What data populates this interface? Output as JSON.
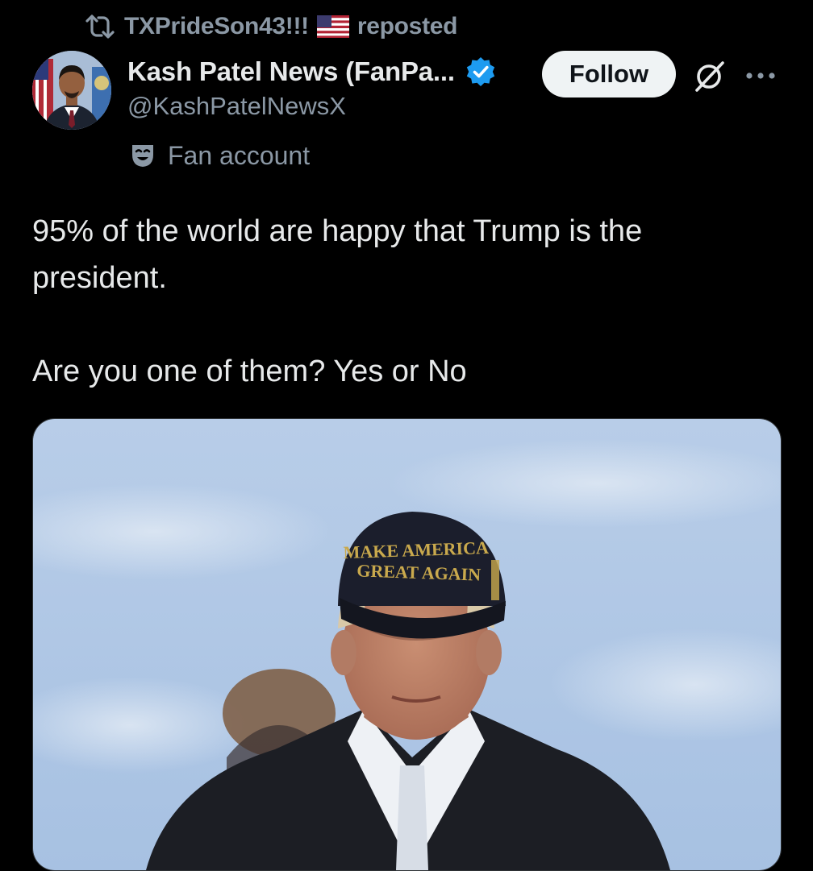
{
  "repost": {
    "user": "TXPrideSon43!!!",
    "label": "reposted",
    "icon": "repost-icon",
    "flag_icon": "us-flag-icon"
  },
  "author": {
    "display_name": "Kash Patel News (FanPa...",
    "handle": "@KashPatelNewsX",
    "verified_icon": "verified-badge-icon",
    "badge_color": "#1d9bf0",
    "account_label": "Fan account",
    "account_label_icon": "mask-icon"
  },
  "actions": {
    "follow_label": "Follow",
    "grok_icon": "grok-icon",
    "more_icon": "more-icon"
  },
  "tweet": {
    "line1": "95% of the world are happy that Trump is the president.",
    "line2": "Are you one of them? Yes or No"
  },
  "media": {
    "cap_line1": "MAKE AMERICA",
    "cap_line2": "GREAT AGAIN"
  }
}
